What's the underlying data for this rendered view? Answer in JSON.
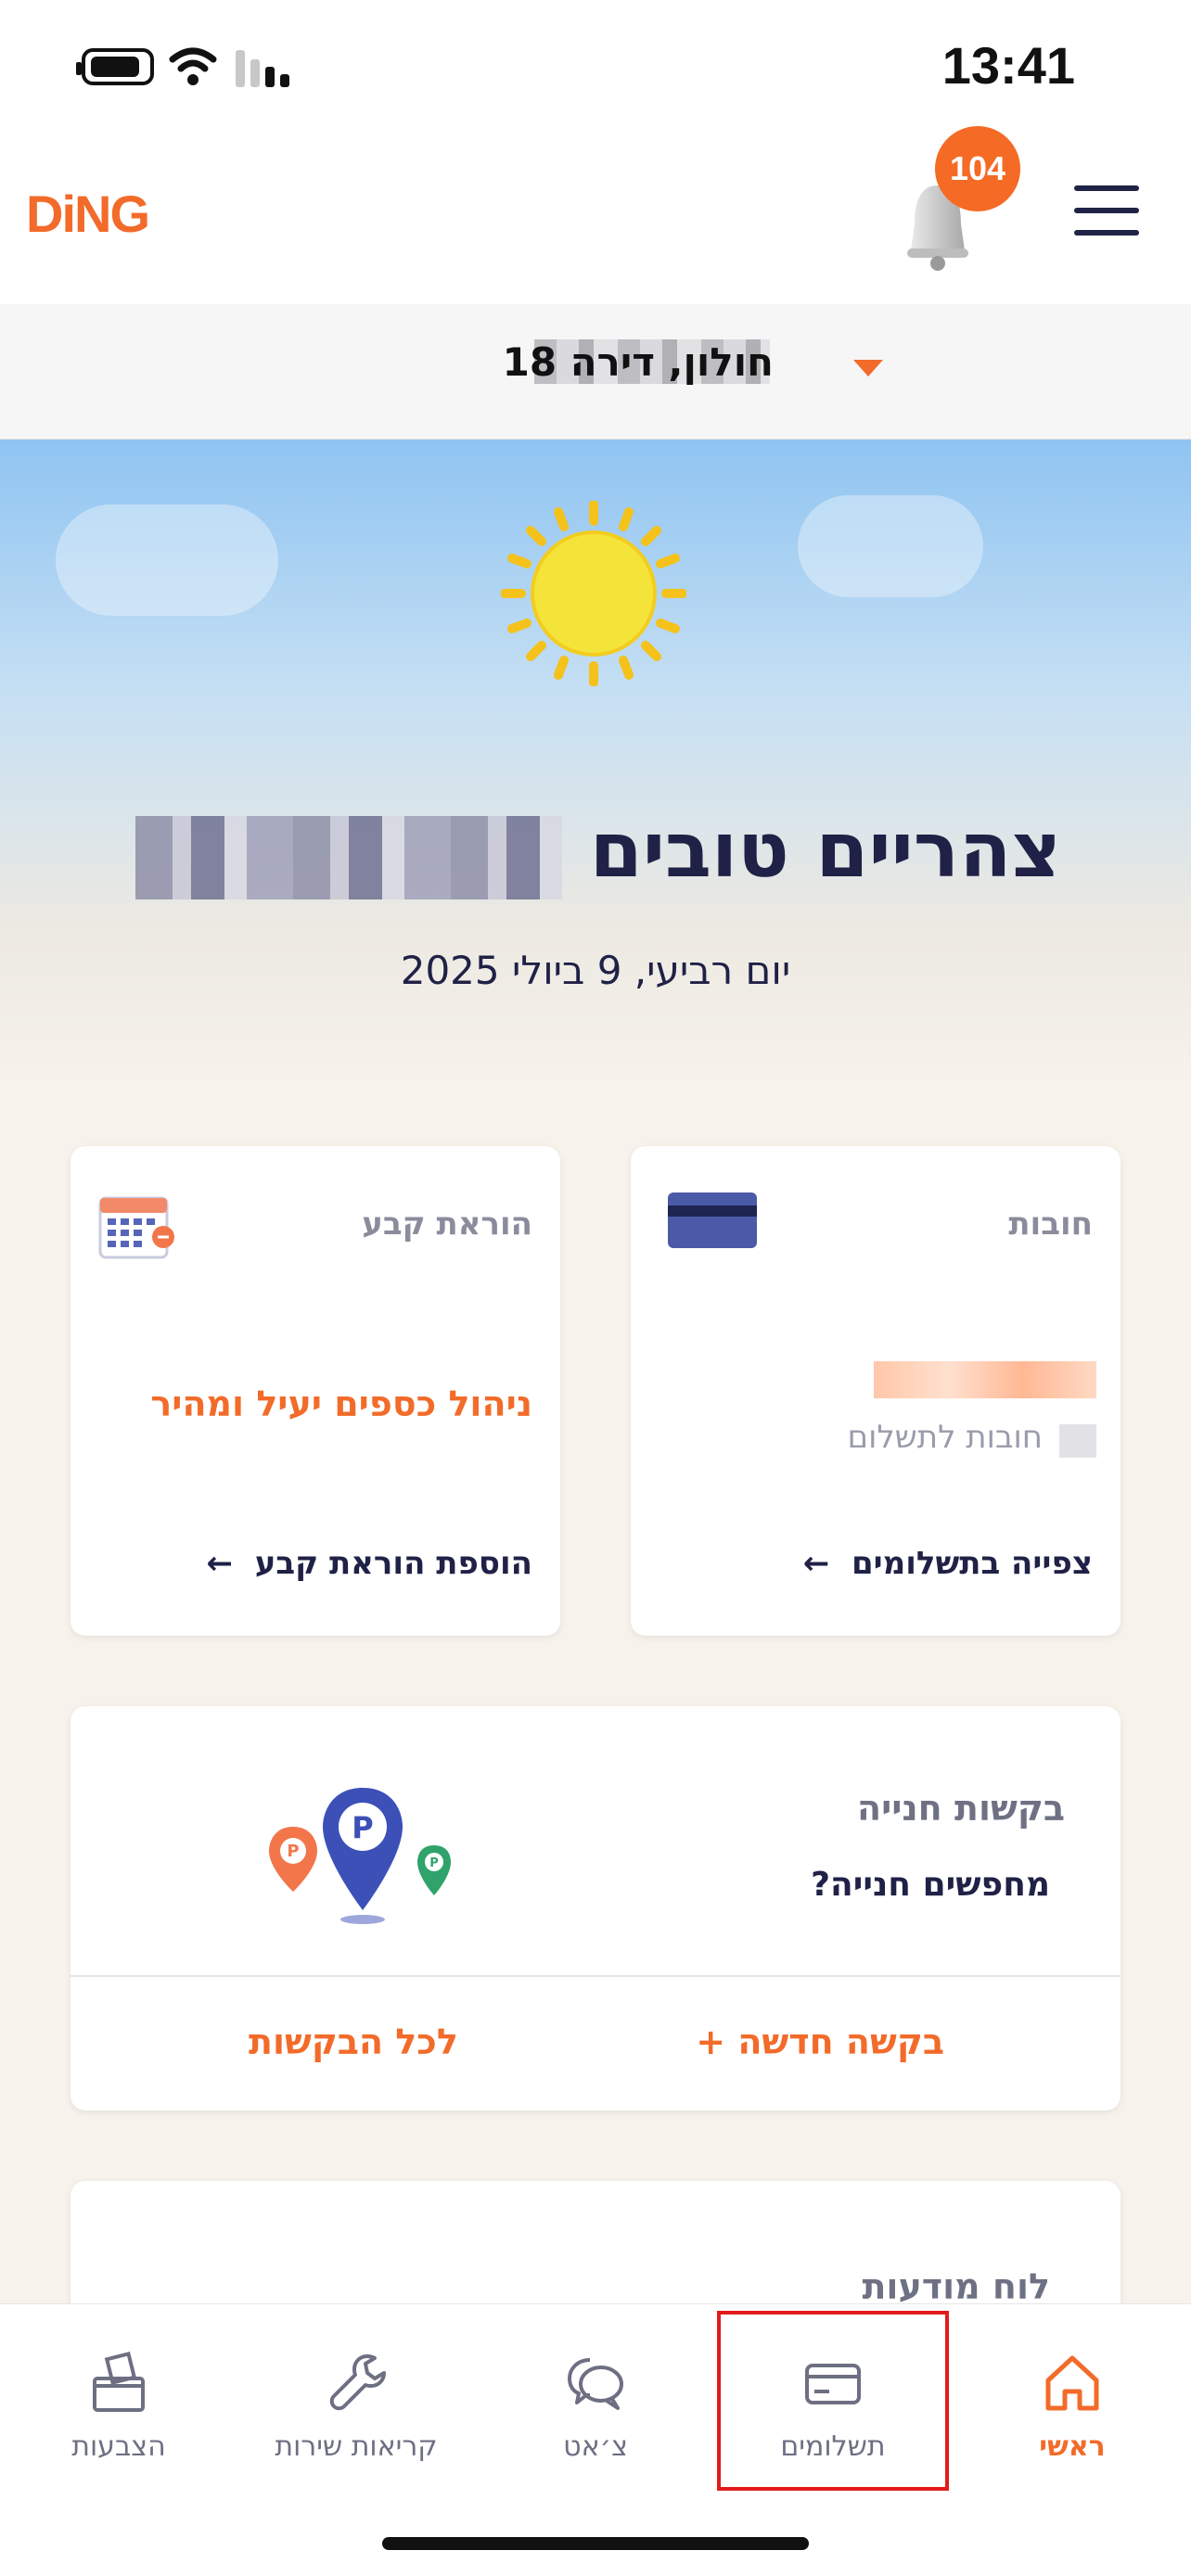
{
  "status_bar": {
    "time": "13:41"
  },
  "header": {
    "logo": "DiNG",
    "notification_count": "104"
  },
  "address": {
    "text": "חולון, דירה 18"
  },
  "greeting": {
    "text": "צהריים טובים",
    "date": "יום רביעי, 9 ביולי 2025"
  },
  "debts_card": {
    "title": "חובות",
    "subtitle": "חובות לתשלום",
    "link": "צפייה בתשלומים"
  },
  "standing_order_card": {
    "title": "הוראת קבע",
    "headline": "ניהול כספים יעיל ומהיר",
    "link": "הוספת הוראת קבע"
  },
  "parking_card": {
    "title": "בקשות חנייה",
    "subtitle": "מחפשים חנייה?",
    "new_request": "בקשה חדשה +",
    "all_requests": "לכל הבקשות"
  },
  "bulletin_card": {
    "title": "לוח מודעות"
  },
  "bottom_nav": {
    "home": "ראשי",
    "payments": "תשלומים",
    "chat": "צ׳אט",
    "service_calls": "קריאות שירות",
    "votes": "הצבעות"
  },
  "colors": {
    "accent": "#f26b2a",
    "navy": "#1f2146",
    "highlight": "#e21b1b"
  }
}
